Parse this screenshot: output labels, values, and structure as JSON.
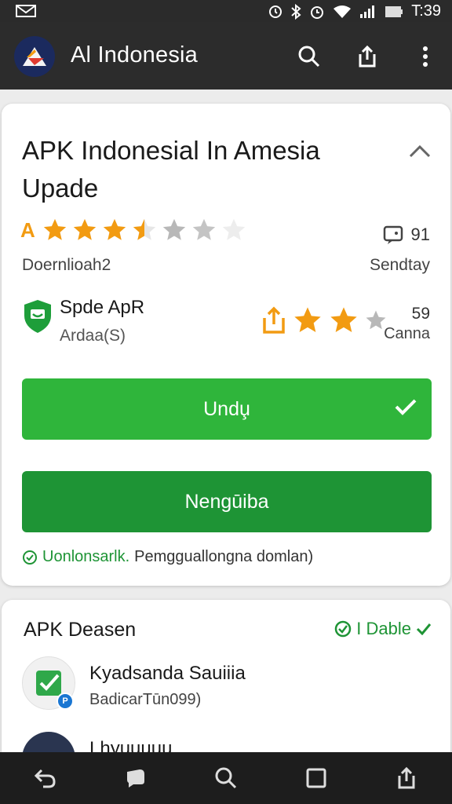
{
  "status_bar": {
    "time": "T:39"
  },
  "app_bar": {
    "title": "Al Indonesia"
  },
  "main_card": {
    "title": "APK Indonesial In Amesia Upade",
    "rating": {
      "prefix": "A",
      "sub": "Doernlioah2"
    },
    "messages": {
      "count": "91",
      "sub": "Sendtay"
    },
    "publisher": {
      "name": "Spde ApR",
      "sub": "Ardaa(S)"
    },
    "share": {
      "count": "59",
      "sub": "Canna"
    },
    "download_label": "Undu̧",
    "install_label": "Nengūiba",
    "footnote": {
      "highlight": "Uonlonsarlk.",
      "text": "Pemgguallongna domlan)"
    }
  },
  "second_card": {
    "title": "APK  Deasen",
    "status": "I Dable",
    "items": [
      {
        "title": "Kyadsanda Sauiiia",
        "sub": "BadicarTūn099)"
      },
      {
        "title": "Lhyuuuuu"
      }
    ]
  },
  "colors": {
    "primary_green": "#2fb53b",
    "dark_green": "#1e9435",
    "star_orange": "#f29b12",
    "app_bar": "#2c2c2c"
  }
}
